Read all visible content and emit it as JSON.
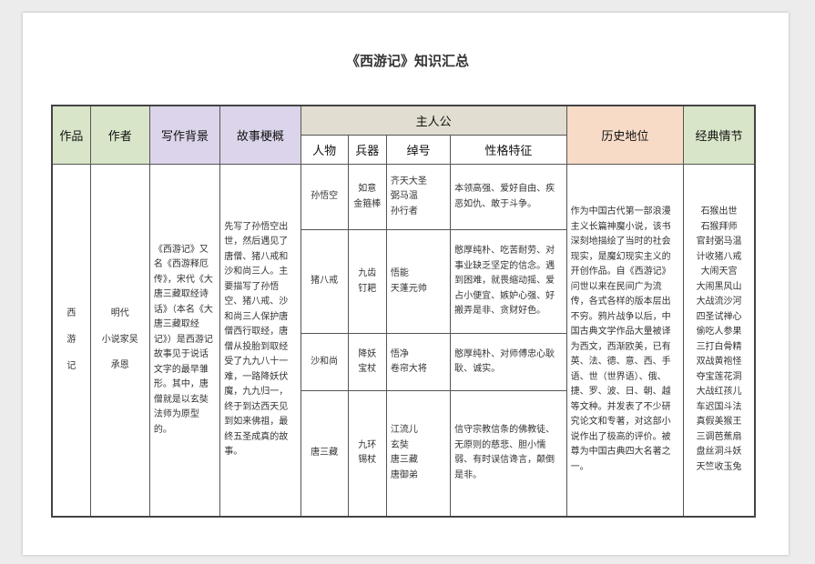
{
  "title": "《西游记》知识汇总",
  "headers": {
    "work": "作品",
    "author": "作者",
    "background": "写作背景",
    "outline": "故事梗概",
    "protagonists": "主人公",
    "history": "历史地位",
    "plots": "经典情节",
    "sub": {
      "person": "人物",
      "weapon": "兵器",
      "alias": "绰号",
      "traits": "性格特征"
    }
  },
  "row": {
    "work": "西\n游\n记",
    "author_dynasty": "明代",
    "author_role": "小说家吴",
    "author_name": "承恩",
    "background": "《西游记》又名《西游释厄传》，宋代《大唐三藏取经诗话》（本名《大唐三藏取经记》）是西游记故事见于说话文字的最早雏形。其中，唐僧就是以玄奘法师为原型的。",
    "outline": "先写了孙悟空出世，然后遇见了唐僧、猪八戒和沙和尚三人。主要描写了孙悟空、猪八戒、沙和尚三人保护唐僧西行取经，唐僧从投胎到取经受了九九八十一难，一路降妖伏魔，九九归一，终于到达西天见到如来佛祖，最终五圣成真的故事。",
    "history": "作为中国古代第一部浪漫主义长篇神魔小说，该书深刻地描绘了当时的社会现实，是魔幻现实主义的开创作品。自《西游记》问世以来在民间广为流传，各式各样的版本层出不穷。鸦片战争以后，中国古典文学作品大量被译为西文，西渐欧美，已有英、法、德、意、西、手语、世（世界语）、俄、捷、罗、波、日、朝、越等文种。并发表了不少研究论文和专著，对这部小说作出了极高的评价。被尊为中国古典四大名著之一。",
    "plots": "石猴出世\n石猴拜师\n官封弼马温\n计收猪八戒\n大闹天宫\n大闹黑风山\n大战流沙河\n四圣试禅心\n偷吃人参果\n三打白骨精\n双战黄袍怪\n夺宝莲花洞\n大战红孩儿\n车迟国斗法\n真假美猴王\n三调芭蕉扇\n盘丝洞斗妖\n天竺收玉兔"
  },
  "characters": [
    {
      "name": "孙悟空",
      "weapon": "如意\n金箍棒",
      "alias": "齐天大圣\n弼马温\n孙行者",
      "traits": "本领高强、爱好自由、疾恶如仇、敢于斗争。"
    },
    {
      "name": "猪八戒",
      "weapon": "九齿\n钉耙",
      "alias": "悟能\n天蓬元帅",
      "traits": "憨厚纯朴、吃苦耐劳、对事业缺乏坚定的信念。遇到困难，就畏缩动摇、爱占小便宜、嫉妒心强、好搬弄是非、贪财好色。"
    },
    {
      "name": "沙和尚",
      "weapon": "降妖\n宝杖",
      "alias": "悟净\n卷帘大将",
      "traits": "憨厚纯朴、对师傅忠心耿耿、诚实。"
    },
    {
      "name": "唐三藏",
      "weapon": "九环\n锡杖",
      "alias": "江流儿\n玄奘\n唐三藏\n唐御弟",
      "traits": "信守宗教信条的佛教徒、无原则的慈悲、胆小懦弱、有时误信谗言，颠倒是非。"
    }
  ]
}
